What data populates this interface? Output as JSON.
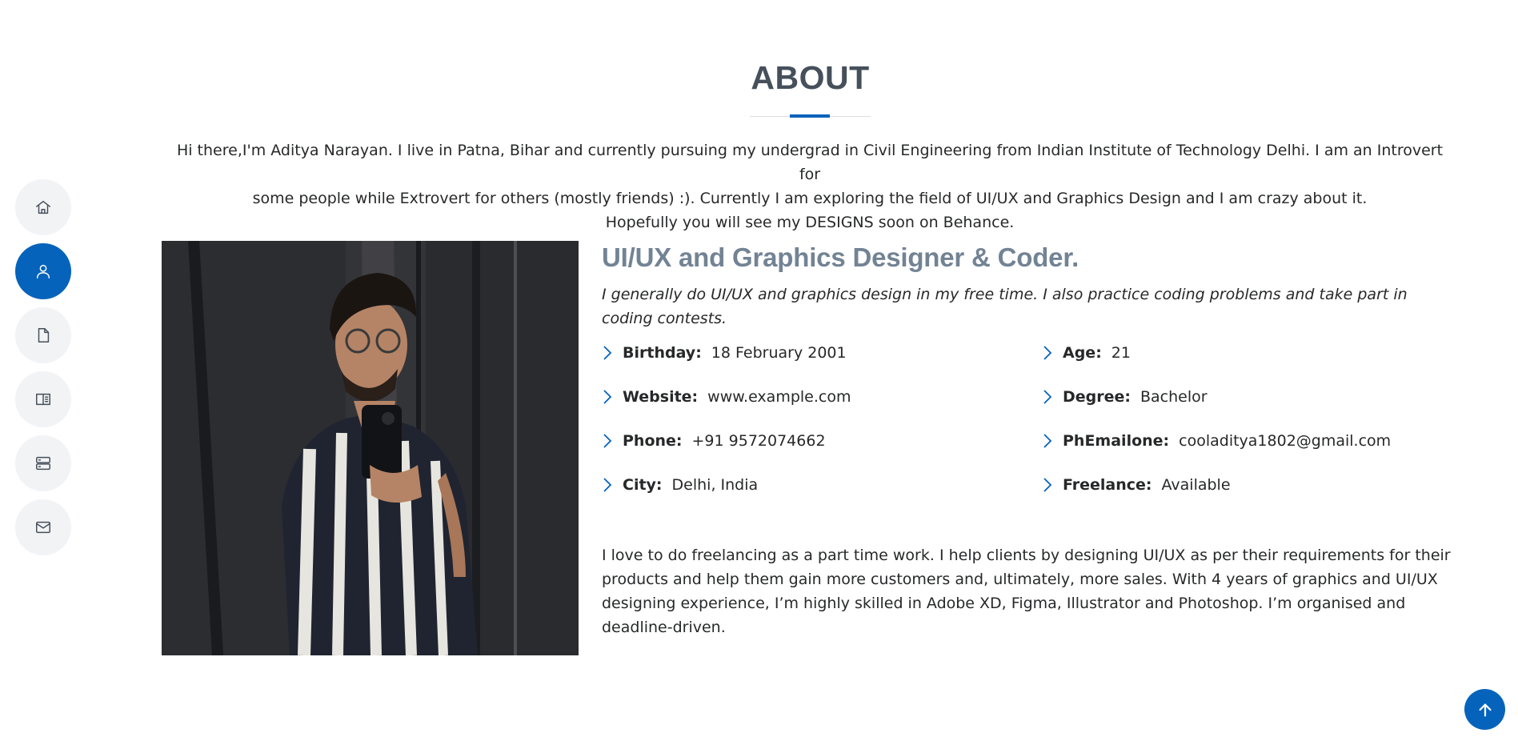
{
  "nav": {
    "items": [
      {
        "icon": "house-icon",
        "active": false
      },
      {
        "icon": "person-icon",
        "active": true
      },
      {
        "icon": "file-icon",
        "active": false
      },
      {
        "icon": "book-icon",
        "active": false
      },
      {
        "icon": "server-icon",
        "active": false
      },
      {
        "icon": "envelope-icon",
        "active": false
      }
    ]
  },
  "about": {
    "title": "ABOUT",
    "intro_line1": "Hi there,I'm Aditya Narayan. I live in Patna, Bihar and currently pursuing my undergrad in Civil Engineering from Indian Institute of Technology Delhi. I am an Introvert for",
    "intro_line2": "some people while Extrovert for others (mostly friends) :). Currently I am exploring the field of UI/UX and Graphics Design and I am crazy about it.",
    "intro_line3": "Hopefully you will see my DESIGNS soon on Behance.",
    "heading": "UI/UX and Graphics Designer & Coder.",
    "lead": "I generally do UI/UX and graphics design in my free time. I also practice coding problems and take part in coding contests.",
    "facts": [
      {
        "label": "Birthday:",
        "value": "18 February 2001"
      },
      {
        "label": "Website:",
        "value": "www.example.com"
      },
      {
        "label": "Phone:",
        "value": "+91 9572074662"
      },
      {
        "label": "City:",
        "value": "Delhi, India"
      },
      {
        "label": "Age:",
        "value": "21"
      },
      {
        "label": "Degree:",
        "value": "Bachelor"
      },
      {
        "label": "PhEmailone:",
        "value": "cooladitya1802@gmail.com"
      },
      {
        "label": "Freelance:",
        "value": "Available"
      }
    ],
    "paragraph": "I love to do freelancing as a part time work. I help clients by designing UI/UX as per their requirements for their products and help them gain more customers and, ultimately, more sales. With 4 years of graphics and UI/UX designing experience, I’m highly skilled in Adobe XD, Figma, Illustrator and Photoshop. I’m organised and deadline-driven."
  },
  "colors": {
    "accent": "#0563bb",
    "heading": "#45505b",
    "subheading": "#728394"
  },
  "back_to_top_icon": "arrow-up-icon"
}
